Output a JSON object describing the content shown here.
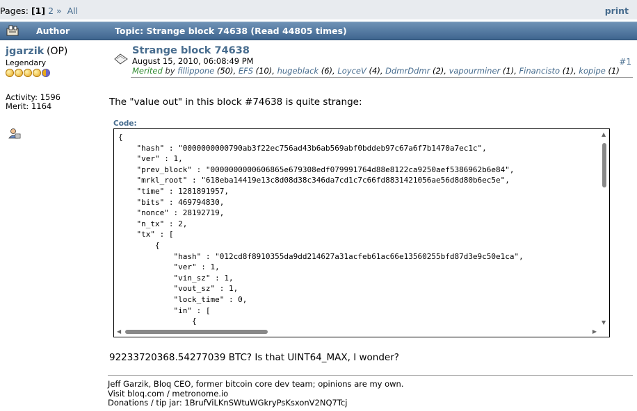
{
  "nav": {
    "pages_label": "Pages: ",
    "current_page": "[1]",
    "page2": "2",
    "next": "»",
    "all": "All",
    "print": "print"
  },
  "header": {
    "author_label": "Author",
    "topic": "Topic: Strange block 74638  (Read 44805 times)"
  },
  "poster": {
    "name": "jgarzik",
    "op": "(OP)",
    "rank": "Legendary",
    "stars": 5,
    "activity": "Activity: 1596",
    "merit": "Merit: 1164"
  },
  "post": {
    "title": "Strange block 74638",
    "date": "August 15, 2010, 06:08:49 PM",
    "merited_label": "Merited",
    "by": "by",
    "number": "#1",
    "body": "The \"value out\" in this block #74638 is quite strange:",
    "code_label": "Code:",
    "code_lines": [
      "{",
      "    \"hash\" : \"0000000000790ab3f22ec756ad43b6ab569abf0bddeb97c67a6f7b1470a7ec1c\",",
      "    \"ver\" : 1,",
      "    \"prev_block\" : \"0000000000606865e679308edf079991764d88e8122ca9250aef5386962b6e84\",",
      "    \"mrkl_root\" : \"618eba14419e13c8d08d38c346da7cd1c7c66fd8831421056ae56d8d80b6ec5e\",",
      "    \"time\" : 1281891957,",
      "    \"bits\" : 469794830,",
      "    \"nonce\" : 28192719,",
      "    \"n_tx\" : 2,",
      "    \"tx\" : [",
      "        {",
      "            \"hash\" : \"012cd8f8910355da9dd214627a31acfeb61ac66e13560255bfd87d3e9c50e1ca\",",
      "            \"ver\" : 1,",
      "            \"vin_sz\" : 1,",
      "            \"vout_sz\" : 1,",
      "            \"lock_time\" : 0,",
      "            \"in\" : [",
      "                {"
    ],
    "after_code": "92233720368.54277039 BTC?  Is that UINT64_MAX, I wonder?"
  },
  "merits": [
    {
      "name": "fillippone",
      "count": "(50)",
      "sep": ", "
    },
    {
      "name": "EFS",
      "count": "(10)",
      "sep": ", "
    },
    {
      "name": "hugeblack",
      "count": "(6)",
      "sep": ", "
    },
    {
      "name": "LoyceV",
      "count": "(4)",
      "sep": ", "
    },
    {
      "name": "DdmrDdmr",
      "count": "(2)",
      "sep": ", "
    },
    {
      "name": "vapourminer",
      "count": "(1)",
      "sep": ", "
    },
    {
      "name": "Financisto",
      "count": "(1)",
      "sep": ", "
    },
    {
      "name": "kopipe",
      "count": "(1)",
      "sep": ""
    }
  ],
  "signature": {
    "line1": "Jeff Garzik, Bloq CEO, former bitcoin core dev team; opinions are my own.",
    "line2": "Visit bloq.com / metronome.io",
    "line3": "Donations / tip jar: 1BrufViLKnSWtuWGkryPsKsxonV2NQ7Tcj"
  },
  "colors": {
    "link": "#476c8e",
    "header_top": "#6f92b6",
    "header_bottom": "#3e658f",
    "merited_green": "#2e8b2e"
  },
  "icons": [
    "thread-icon",
    "message-icon",
    "profile-icon",
    "star-icon"
  ]
}
